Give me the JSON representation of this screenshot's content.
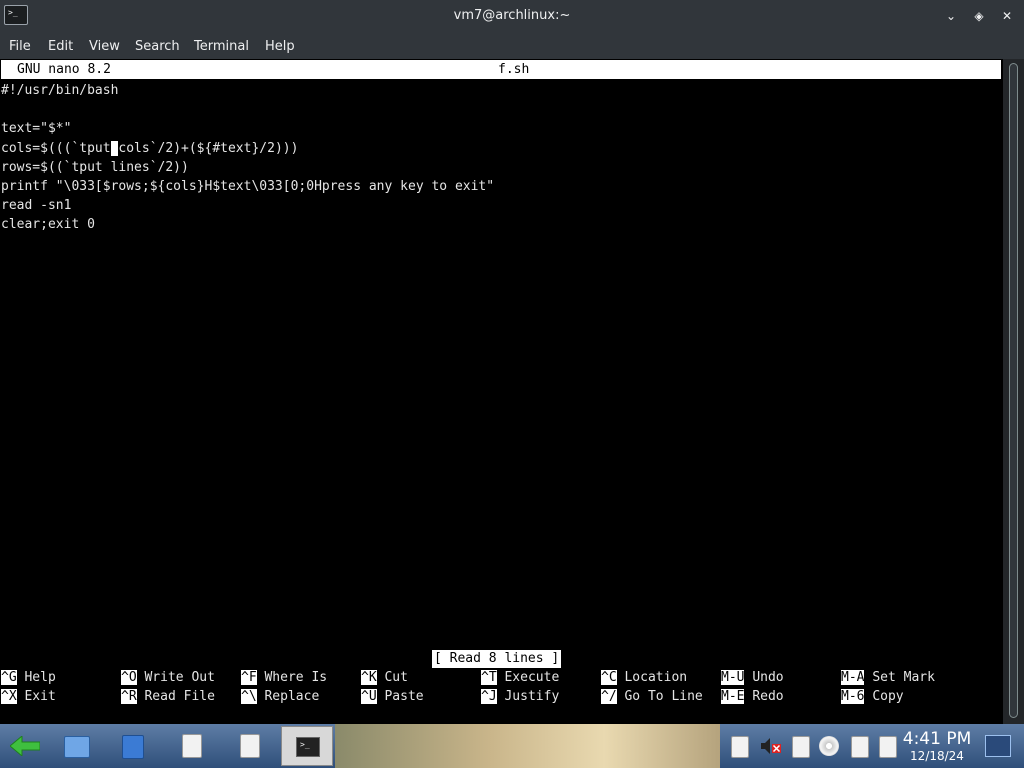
{
  "window": {
    "title": "vm7@archlinux:~",
    "app_icon_glyph": ">_"
  },
  "menu": [
    "File",
    "Edit",
    "View",
    "Search",
    "Terminal",
    "Help"
  ],
  "nano": {
    "version": "GNU nano 8.2",
    "filename": "f.sh",
    "lines": [
      "#!/usr/bin/bash",
      "",
      "text=\"$*\"",
      "",
      "",
      "rows=$((`tput lines`/2))",
      "printf \"\\033[$rows;${cols}H$text\\033[0;0Hpress any key to exit\"",
      "read -sn1",
      "clear;exit 0"
    ],
    "cursor_line": {
      "before": "cols=$(((`tput",
      "cursor": " ",
      "after": "cols`/2)+(${#text}/2)))"
    },
    "status": "[ Read 8 lines ]",
    "shortcuts_row1": [
      {
        "key": "^G",
        "label": "Help"
      },
      {
        "key": "^O",
        "label": "Write Out"
      },
      {
        "key": "^F",
        "label": "Where Is"
      },
      {
        "key": "^K",
        "label": "Cut"
      },
      {
        "key": "^T",
        "label": "Execute"
      },
      {
        "key": "^C",
        "label": "Location"
      },
      {
        "key": "M-U",
        "label": "Undo"
      },
      {
        "key": "M-A",
        "label": "Set Mark"
      }
    ],
    "shortcuts_row2": [
      {
        "key": "^X",
        "label": "Exit"
      },
      {
        "key": "^R",
        "label": "Read File"
      },
      {
        "key": "^\\",
        "label": "Replace"
      },
      {
        "key": "^U",
        "label": "Paste"
      },
      {
        "key": "^J",
        "label": "Justify"
      },
      {
        "key": "^/",
        "label": "Go To Line"
      },
      {
        "key": "M-E",
        "label": "Redo"
      },
      {
        "key": "M-6",
        "label": "Copy"
      }
    ]
  },
  "taskbar": {
    "time": "4:41 PM",
    "date": "12/18/24",
    "task_glyph": ">_"
  },
  "colors": {
    "titlebar": "#31363b",
    "terminal_bg": "#000000",
    "terminal_fg": "#e5e5e5",
    "nano_bar": "#ffffff"
  }
}
